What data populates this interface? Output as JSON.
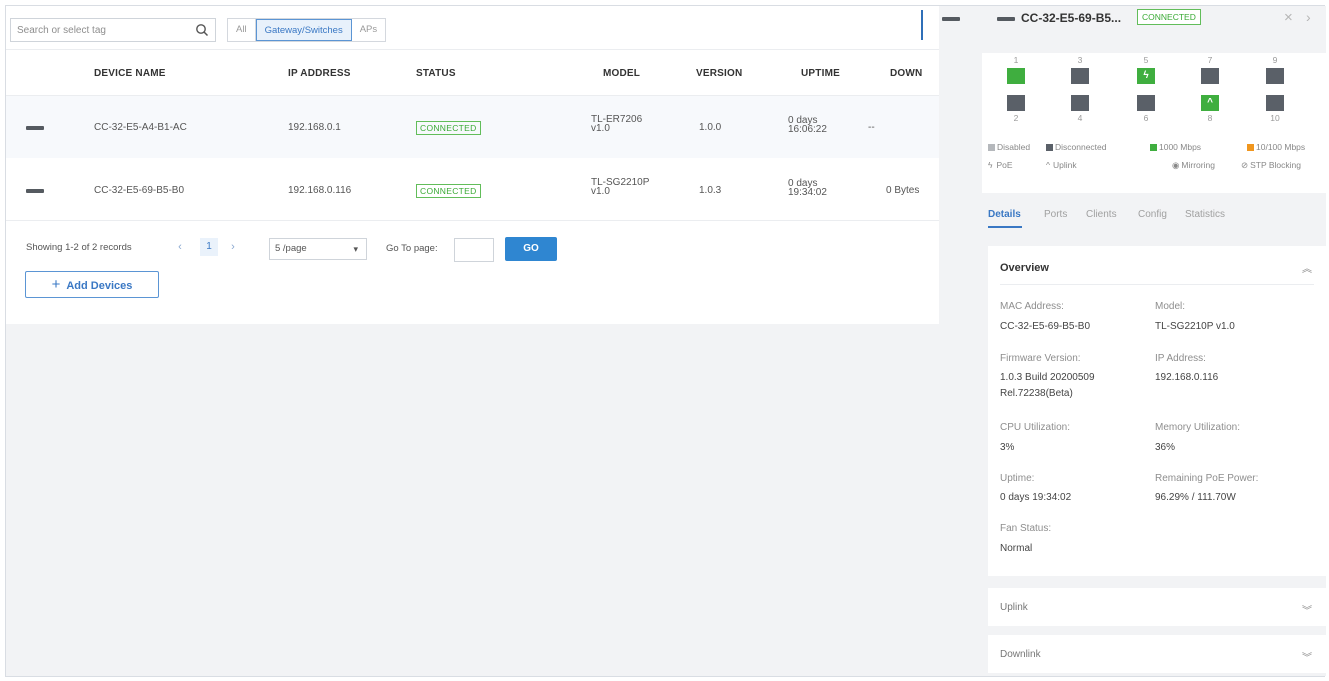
{
  "search": {
    "placeholder": "Search or select tag"
  },
  "filters": [
    "All",
    "Gateway/Switches",
    "APs"
  ],
  "table": {
    "columns": [
      "DEVICE NAME",
      "IP ADDRESS",
      "STATUS",
      "MODEL",
      "VERSION",
      "UPTIME",
      "DOWN"
    ],
    "rows": [
      {
        "name": "CC-32-E5-A4-B1-AC",
        "ip": "192.168.0.1",
        "status": "CONNECTED",
        "model_line1": "TL-ER7206",
        "model_line2": "v1.0",
        "version": "1.0.0",
        "uptime_line1": "0 days",
        "uptime_line2": "16:06:22",
        "down": "--"
      },
      {
        "name": "CC-32-E5-69-B5-B0",
        "ip": "192.168.0.116",
        "status": "CONNECTED",
        "model_line1": "TL-SG2210P",
        "model_line2": "v1.0",
        "version": "1.0.3",
        "uptime_line1": "0 days",
        "uptime_line2": "19:34:02",
        "down": "0 Bytes"
      }
    ]
  },
  "pager": {
    "showing": "Showing 1-2 of 2 records",
    "prev": "‹",
    "current": "1",
    "next": "›",
    "page_size": "5 /page",
    "goto_label": "Go To page:",
    "go": "GO"
  },
  "add_devices": "Add Devices",
  "detail": {
    "title": "CC-32-E5-69-B5...",
    "status": "CONNECTED",
    "close": "×",
    "next": "›",
    "port_numbers_top": [
      "1",
      "3",
      "5",
      "7",
      "9"
    ],
    "port_numbers_bottom": [
      "2",
      "4",
      "6",
      "8",
      "10"
    ],
    "legend": {
      "disabled": "Disabled",
      "disconnected": "Disconnected",
      "m1000": "1000 Mbps",
      "m10_100": "10/100 Mbps",
      "poe": "PoE",
      "uplink": "Uplink",
      "mirroring": "Mirroring",
      "stp": "STP Blocking"
    },
    "tabs": [
      "Details",
      "Ports",
      "Clients",
      "Config",
      "Statistics"
    ],
    "overview": {
      "title": "Overview",
      "mac_label": "MAC Address:",
      "mac": "CC-32-E5-69-B5-B0",
      "model_label": "Model:",
      "model": "TL-SG2210P v1.0",
      "fw_label": "Firmware Version:",
      "fw_line1": "1.0.3 Build 20200509",
      "fw_line2": "Rel.72238(Beta)",
      "ip_label": "IP Address:",
      "ip": "192.168.0.116",
      "cpu_label": "CPU Utilization:",
      "cpu": "3%",
      "mem_label": "Memory Utilization:",
      "mem": "36%",
      "uptime_label": "Uptime:",
      "uptime": "0 days 19:34:02",
      "poe_label": "Remaining PoE Power:",
      "poe": "96.29% / 111.70W",
      "fan_label": "Fan Status:",
      "fan": "Normal"
    },
    "uplink": "Uplink",
    "downlink": "Downlink"
  },
  "colors": {
    "accent": "#2f86d1",
    "connected": "#3aaa35",
    "port_off": "#5a6068",
    "port_1000": "#3fae3f",
    "port_100": "#f0961e",
    "disabled": "#b5b8bc"
  }
}
